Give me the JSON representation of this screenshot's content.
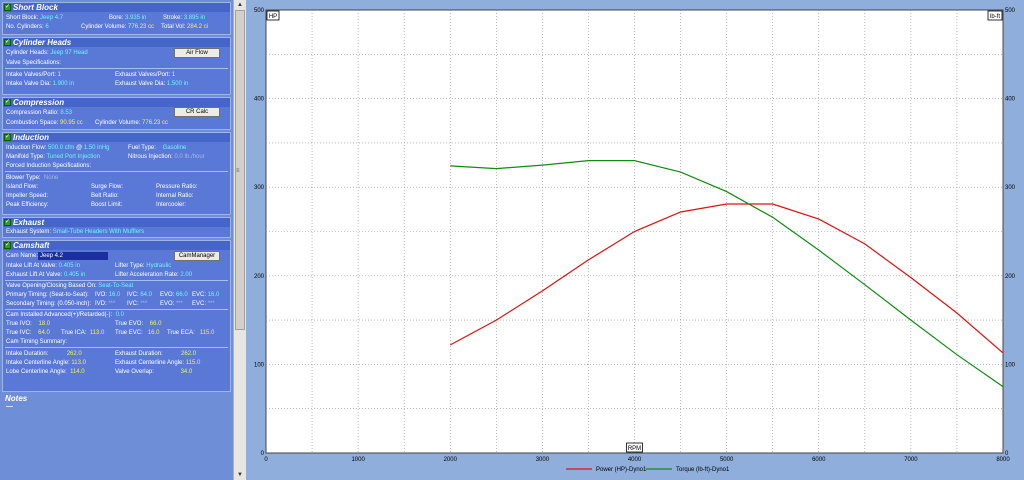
{
  "short_block": {
    "title": "Short Block",
    "short_block_label": "Short Block:",
    "short_block_value": "Jeep 4.7",
    "bore_label": "Bore:",
    "bore_value": "3.935 in",
    "stroke_label": "Stroke:",
    "stroke_value": "3.895 in",
    "cylinders_label": "No. Cylinders:",
    "cylinders_value": "6",
    "cylinder_volume_label": "Cylinder Volume:",
    "cylinder_volume_value": "776.23 cc",
    "total_vol_label": "Total Vol:",
    "total_vol_value": "284.2 ci"
  },
  "cylinder_heads": {
    "title": "Cylinder Heads",
    "heads_label": "Cylinder Heads:",
    "heads_value": "Jeep 97 Head",
    "airflow_button": "Air Flow",
    "valve_specs_label": "Valve Specifications:",
    "intake_valves_label": "Intake Valves/Port:",
    "intake_valves_value": "1",
    "exhaust_valves_label": "Exhaust Valves/Port:",
    "exhaust_valves_value": "1",
    "intake_dia_label": "Intake Valve Dia:",
    "intake_dia_value": "1.900 in",
    "exhaust_dia_label": "Exhaust Valve Dia:",
    "exhaust_dia_value": "1.500 in"
  },
  "compression": {
    "title": "Compression",
    "ratio_label": "Compression Ratio:",
    "ratio_value": "8.53",
    "crcalc_button": "CR Calc",
    "combustion_label": "Combustion Space:",
    "combustion_value": "90.95 cc",
    "cyl_vol_label": "Cylinder Volume:",
    "cyl_vol_value": "776.23 cc"
  },
  "induction": {
    "title": "Induction",
    "flow_label": "Induction Flow:",
    "flow_value": "500.0 cfm",
    "flow_at": "@",
    "flow_hg": "1.50 inHg",
    "fuel_label": "Fuel Type:",
    "fuel_value": "Gasoline",
    "manifold_label": "Manifold Type:",
    "manifold_value": "Tuned Port Injection",
    "nitrous_label": "Nitrous Injection:",
    "nitrous_value": "0.0 Ib./hour",
    "forced_label": "Forced Induction Specifications:",
    "blower_label": "Blower Type:",
    "blower_value": "None",
    "island_label": "Island Flow:",
    "island_value": "",
    "surge_label": "Surge Flow:",
    "surge_value": "",
    "pressure_label": "Pressure Ratio:",
    "pressure_value": "",
    "impeller_label": "Impeller Speed:",
    "impeller_value": "",
    "belt_label": "Belt Ratio:",
    "belt_value": "",
    "internal_label": "Internal Ratio:",
    "internal_value": "",
    "peak_label": "Peak Efficiency:",
    "peak_value": "",
    "boost_label": "Boost Limit:",
    "boost_value": "",
    "intercooler_label": "Intercooler:",
    "intercooler_value": ""
  },
  "exhaust": {
    "title": "Exhaust",
    "system_label": "Exhaust System:",
    "system_value": "Small-Tube Headers With Mufflers"
  },
  "camshaft": {
    "title": "Camshaft",
    "cam_name_label": "Cam Name:",
    "cam_name_value": "Jeep 4.2",
    "cam_manager_button": "CamManager",
    "intake_lift_label": "Intake Lift At Valve:",
    "intake_lift_value": "0.405 in",
    "lifter_label": "Lifter Type:",
    "lifter_value": "Hydraulic",
    "exhaust_lift_label": "Exhaust Lift At Valve:",
    "exhaust_lift_value": "0.405 in",
    "lifter_accel_label": "Lifter Acceleration Rate:",
    "lifter_accel_value": "2.00",
    "based_on_label": "Valve Opening/Closing Based On:",
    "based_on_value": "Seat-To-Seat",
    "primary_label": "Primary Timing: (Seat-to-Seat):",
    "ivo_label": "IVO:",
    "ivo_value": "16.0",
    "ivc_label": "IVC:",
    "ivc_value": "64.0",
    "evo_label": "EVO:",
    "evo_value": "66.0",
    "evc_label": "EVC:",
    "evc_value": "16.0",
    "secondary_label": "Secondary Timing: (0.050-inch):",
    "s_ivo_label": "IVD:",
    "s_ivo_value": "***",
    "s_ivc_label": "IVC:",
    "s_ivc_value": "***",
    "s_evo_label": "EVO:",
    "s_evo_value": "***",
    "s_evc_label": "EVC:",
    "s_evc_value": "***",
    "installed_label": "Cam Installed Advanced(+)/Retarded(-):",
    "installed_value": "0.0",
    "true_ivo_label": "True IVO:",
    "true_ivo_value": "18.0",
    "true_evo_label": "True EVO:",
    "true_evo_value": "66.0",
    "true_ivc_label": "True IVC:",
    "true_ivc_value": "64.0",
    "true_ica_label": "True ICA:",
    "true_ica_value": "113.0",
    "true_evc_label": "True EVC:",
    "true_evc_value": "16.0",
    "true_eca_label": "True ECA:",
    "true_eca_value": "115.0",
    "summary_label": "Cam Timing Summary:",
    "intake_dur_label": "Intake Duration:",
    "intake_dur_value": "262.0",
    "exhaust_dur_label": "Exhaust Duration:",
    "exhaust_dur_value": "262.0",
    "intake_cl_label": "Intake Centerline Angle:",
    "intake_cl_value": "113.0",
    "exhaust_cl_label": "Exhaust Centerline Angle:",
    "exhaust_cl_value": "115.0",
    "lobe_cl_label": "Lobe Centerline Angle:",
    "lobe_cl_value": "114.0",
    "overlap_label": "Valve Overlap:",
    "overlap_value": "34.0"
  },
  "notes": {
    "title": "Notes",
    "text": ""
  },
  "chart_data": {
    "type": "line",
    "xlabel": "RPM",
    "ylabel_left": "HP",
    "ylabel_right": "lb-ft",
    "xlim": [
      0,
      8000
    ],
    "ylim": [
      0,
      500
    ],
    "x_ticks": [
      0,
      1000,
      2000,
      3000,
      4000,
      5000,
      6000,
      7000,
      8000
    ],
    "y_ticks": [
      100,
      200,
      300,
      400,
      500
    ],
    "grid": true,
    "legend_position": "bottom",
    "series": [
      {
        "name": "Power (HP)-Dyno1",
        "color": "#e01010",
        "x": [
          2000,
          2500,
          3000,
          3500,
          4000,
          4500,
          5000,
          5500,
          6000,
          6500,
          7000,
          7500,
          8000
        ],
        "y": [
          122,
          150,
          183,
          218,
          250,
          272,
          281,
          281,
          264,
          236,
          198,
          158,
          113
        ]
      },
      {
        "name": "Torque (lb-ft)-Dyno1",
        "color": "#108a10",
        "x": [
          2000,
          2500,
          3000,
          3500,
          4000,
          4500,
          5000,
          5500,
          6000,
          6500,
          7000,
          7500,
          8000
        ],
        "y": [
          324,
          321,
          325,
          330,
          330,
          317,
          295,
          266,
          229,
          190,
          150,
          111,
          75
        ]
      }
    ]
  }
}
